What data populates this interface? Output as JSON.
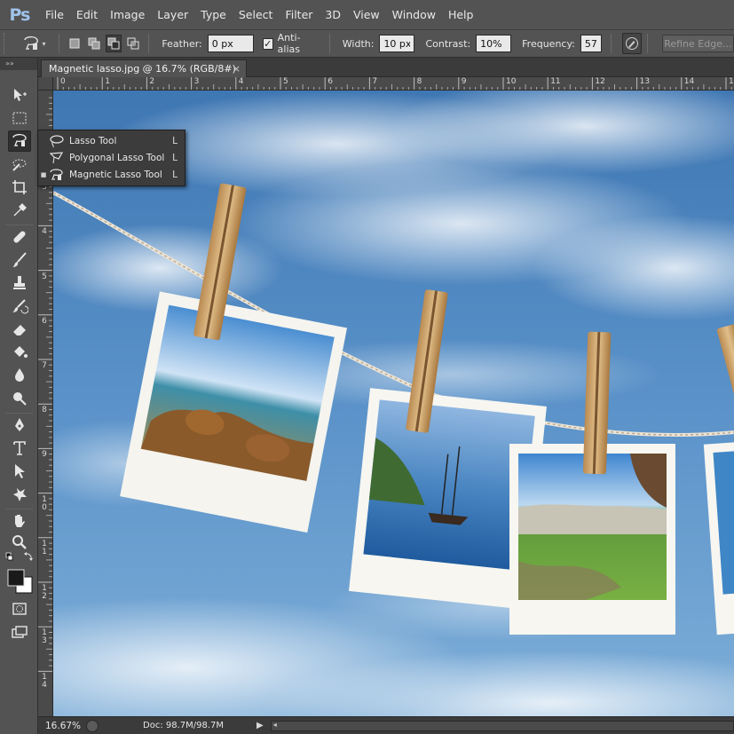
{
  "app": {
    "logo": "Ps"
  },
  "menu": [
    "File",
    "Edit",
    "Image",
    "Layer",
    "Type",
    "Select",
    "Filter",
    "3D",
    "View",
    "Window",
    "Help"
  ],
  "options": {
    "feather_label": "Feather:",
    "feather_value": "0 px",
    "antialias_label": "Anti-alias",
    "antialias_checked": true,
    "width_label": "Width:",
    "width_value": "10 px",
    "contrast_label": "Contrast:",
    "contrast_value": "10%",
    "frequency_label": "Frequency:",
    "frequency_value": "57",
    "refine_label": "Refine Edge..."
  },
  "toolbar": {
    "header": "»»"
  },
  "document": {
    "tab_title": "Magnetic lasso.jpg @ 16.7% (RGB/8#)",
    "close_glyph": "×"
  },
  "rulers": {
    "top": [
      "0",
      "1",
      "2",
      "3",
      "4",
      "5",
      "6",
      "7",
      "8",
      "9",
      "10",
      "11",
      "12",
      "13",
      "14",
      "15"
    ],
    "left": [
      "2",
      "3",
      "4",
      "5",
      "6",
      "7",
      "8",
      "9",
      "10",
      "11",
      "12",
      "13",
      "14"
    ]
  },
  "flyout": {
    "items": [
      {
        "label": "Lasso Tool",
        "shortcut": "L",
        "selected": false
      },
      {
        "label": "Polygonal Lasso Tool",
        "shortcut": "L",
        "selected": false
      },
      {
        "label": "Magnetic Lasso Tool",
        "shortcut": "L",
        "selected": true
      }
    ]
  },
  "status": {
    "zoom": "16.67%",
    "doc": "Doc: 98.7M/98.7M",
    "arrow": "▶",
    "scroll_left": "◂"
  },
  "colors": {
    "chrome": "#535353",
    "sky": "#4a84bf",
    "accent_logo": "#9fc3ea"
  }
}
